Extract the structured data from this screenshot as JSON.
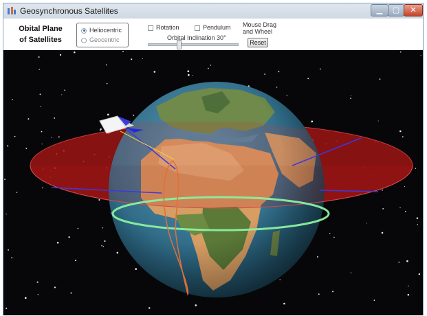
{
  "window": {
    "title": "Geosynchronous Satellites"
  },
  "controls": {
    "plane_title_line1": "Obital Plane",
    "plane_title_line2": "of Satellites",
    "radio_heliocentric": "Heliocentric",
    "radio_geocentric": "Geocentric",
    "selected_frame": "Heliocentric",
    "check_rotation": "Rotation",
    "check_pendulum": "Pendulum",
    "inclination_label": "Orbital Inclination  30°",
    "inclination_deg": 30,
    "mouse_hint_line1": "Mouse Drag",
    "mouse_hint_line2": "and Wheel",
    "reset_label": "Reset"
  },
  "colors": {
    "orbital_plane": "#9e1414",
    "equator": "#8af0a0",
    "figure_eight": "#e0703a",
    "satellite_line": "#e8d040",
    "space": "#07070a",
    "ocean": "#2e6a86"
  }
}
